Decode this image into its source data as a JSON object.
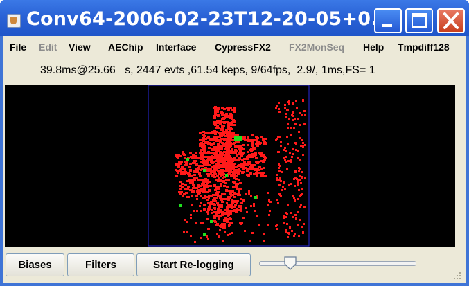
{
  "window": {
    "title": "Conv64-2006-02-23T12-20-05+0...",
    "icon": "java-cup-icon",
    "controls": [
      "minimize-icon",
      "maximize-icon",
      "close-icon"
    ]
  },
  "menu": {
    "items": [
      {
        "label": "File",
        "enabled": true
      },
      {
        "label": "Edit",
        "enabled": false
      },
      {
        "label": "View",
        "enabled": true
      },
      {
        "label": "AEChip",
        "enabled": true
      },
      {
        "label": "Interface",
        "enabled": true
      },
      {
        "label": "CypressFX2",
        "enabled": true
      },
      {
        "label": "FX2MonSeq",
        "enabled": false
      },
      {
        "label": "Help",
        "enabled": true
      },
      {
        "label": "Tmpdiff128",
        "enabled": true
      }
    ]
  },
  "status": {
    "text": "39.8ms@25.66   s, 2447 evts ,61.54 keps, 9/64fps,  2.9/, 1ms,FS= 1"
  },
  "display": {
    "background": "#000000",
    "frame_color": "#2a2ae0",
    "on_color": "#ff1a1a",
    "off_color": "#1fe01f"
  },
  "controls": {
    "biases_label": "Biases",
    "filters_label": "Filters",
    "relogging_label": "Start Re-logging",
    "slider_fraction": 0.2
  },
  "colors": {
    "titlebar": "#2a62d6",
    "panel": "#ece9d8",
    "close_button": "#c9401e"
  }
}
